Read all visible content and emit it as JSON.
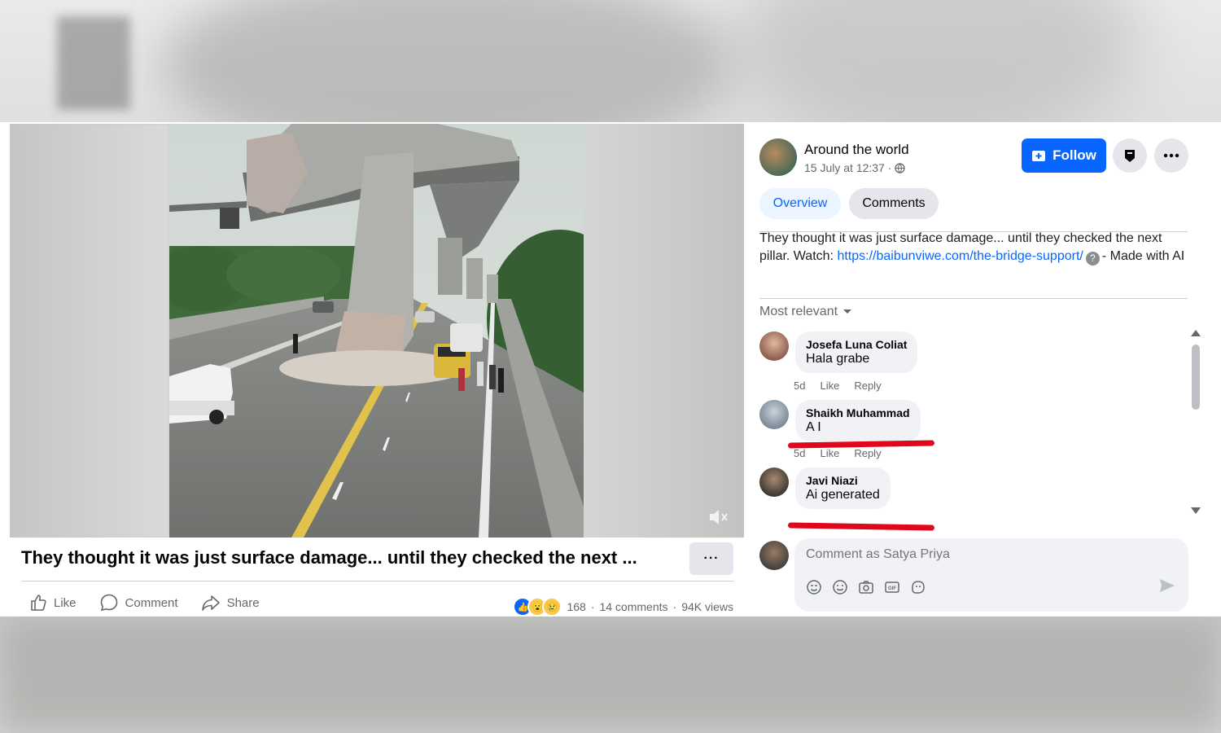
{
  "page": {
    "name": "Around the world",
    "date": "15 July at 12:37 ·",
    "follow_label": "Follow"
  },
  "tabs": {
    "overview": "Overview",
    "comments": "Comments"
  },
  "post": {
    "title": "They thought it was just surface damage... until they checked the next ...",
    "description_text": "They thought it was just surface damage... until they checked the next pillar. Watch:",
    "link": "https://baibunviwe.com/the-bridge-support/",
    "description_suffix": "- Made with AI",
    "more_label": "···"
  },
  "actions": {
    "like": "Like",
    "comment": "Comment",
    "share": "Share"
  },
  "stats": {
    "reaction_count": "168",
    "comments": "14 comments",
    "views": "94K views",
    "separator": "·"
  },
  "sort_label": "Most relevant",
  "comments": [
    {
      "name": "Josefa Luna Coliat",
      "text": "Hala grabe",
      "time": "5d",
      "like": "Like",
      "reply": "Reply"
    },
    {
      "name": "Shaikh Muhammad",
      "text": "A I",
      "time": "5d",
      "like": "Like",
      "reply": "Reply"
    },
    {
      "name": "Javi Niazi",
      "text": "Ai generated"
    }
  ],
  "composer": {
    "placeholder": "Comment as Satya Priya"
  },
  "colors": {
    "accent": "#0866ff",
    "annotation_red": "#e0061c",
    "muted": "#65676b"
  },
  "icons": [
    "like-icon",
    "comment-icon",
    "share-icon",
    "bookmark-icon",
    "more-icon",
    "globe-icon",
    "mute-icon",
    "sticker-icon",
    "emoji-icon",
    "camera-icon",
    "gif-icon",
    "avatar-sticker-icon",
    "send-icon"
  ]
}
